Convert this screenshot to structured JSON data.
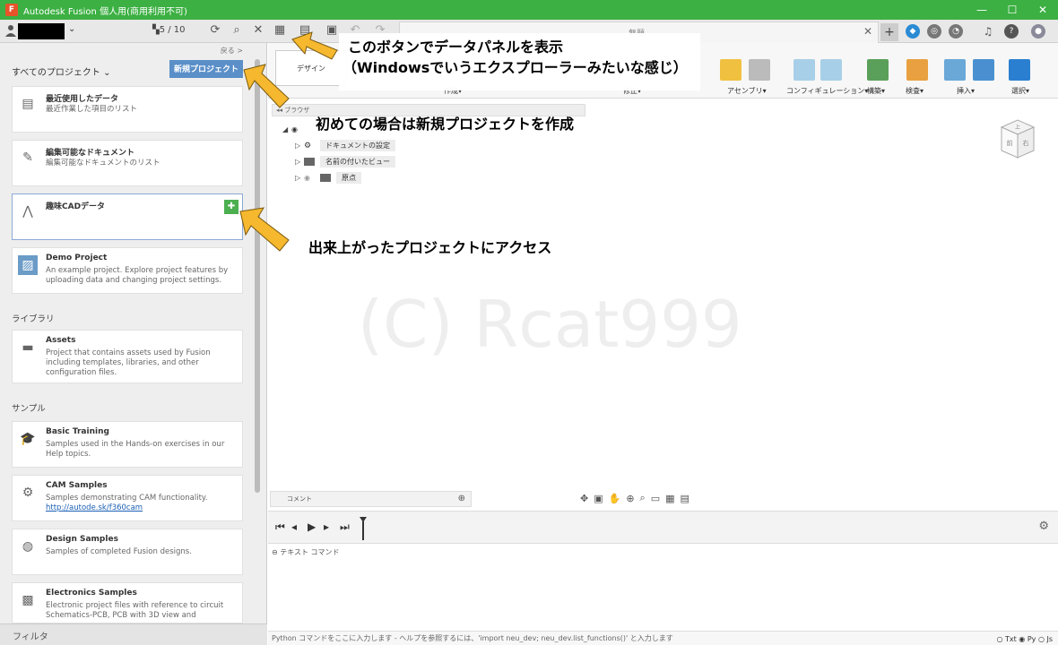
{
  "window": {
    "title": "Autodesk Fusion 個人用(商用利用不可)",
    "controls": [
      "—",
      "☐",
      "✕"
    ]
  },
  "appbar": {
    "job_status": "5 / 10",
    "doc_tab_title": "無題"
  },
  "data_panel": {
    "back_link": "戻る >",
    "all_projects_label": "すべてのプロジェクト",
    "new_project_button": "新規プロジェクト",
    "cards_top": [
      {
        "title": "最近使用したデータ",
        "desc": "最近作業した項目のリスト"
      },
      {
        "title": "編集可能なドキュメント",
        "desc": "編集可能なドキュメントのリスト"
      },
      {
        "title": "趣味CADデータ",
        "desc": ""
      },
      {
        "title": "Demo Project",
        "desc": "An example project. Explore project features by uploading data and changing project settings."
      }
    ],
    "library_heading": "ライブラリ",
    "library_cards": [
      {
        "title": "Assets",
        "desc": "Project that contains assets used by Fusion including templates, libraries, and other configuration files."
      }
    ],
    "samples_heading": "サンプル",
    "sample_cards": [
      {
        "title": "Basic Training",
        "desc": "Samples used in the Hands-on exercises in our Help topics."
      },
      {
        "title": "CAM Samples",
        "desc": "Samples demonstrating CAM functionality.",
        "link": "http://autode.sk/f360cam"
      },
      {
        "title": "Design Samples",
        "desc": "Samples of completed Fusion designs."
      },
      {
        "title": "Electronics Samples",
        "desc": "Electronic project files with reference to circuit Schematics-PCB, PCB with 3D view and"
      }
    ],
    "filter_label": "フィルタ"
  },
  "ribbon": {
    "workspace_label": "デザイン",
    "groups": [
      "作成▾",
      "修正▾",
      "アセンブリ▾",
      "コンフィギュレーション▾",
      "構築▾",
      "検査▾",
      "挿入▾",
      "選択▾"
    ]
  },
  "viewport": {
    "browser_label": "ブラウザ",
    "tree": [
      "ドキュメントの設定",
      "名前の付いたビュー",
      "原点"
    ],
    "watermark": "(C) Rcat999",
    "comment_label": "コメント",
    "viewcube_faces": [
      "上",
      "前",
      "右"
    ]
  },
  "textcmd": {
    "header": "テキスト コマンド",
    "input_hint": "Python コマンドをここに入力します - ヘルプを参照するには、'import neu_dev; neu_dev.list_functions()' と入力します",
    "modes": [
      "Txt",
      "Py",
      "Js"
    ]
  },
  "annotations": {
    "data_panel_button_line1": "このボタンでデータパネルを表示",
    "data_panel_button_line2": "（Windowsでいうエクスプローラーみたいな感じ）",
    "new_project": "初めての場合は新規プロジェクトを作成",
    "access_project": "出来上がったプロジェクトにアクセス"
  },
  "colors": {
    "titlebar": "#3cb043",
    "primary_button": "#5a8fc8",
    "arrow": "#f5b82e"
  }
}
